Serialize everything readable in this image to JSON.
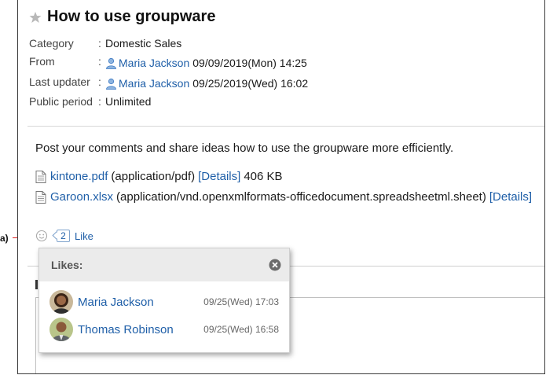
{
  "title": "How to use groupware",
  "meta": [
    {
      "label": "Category",
      "value": "Domestic Sales"
    },
    {
      "label": "From",
      "user": "Maria Jackson",
      "value": "09/09/2019(Mon) 14:25"
    },
    {
      "label": "Last updater",
      "user": "Maria Jackson",
      "value": "09/25/2019(Wed) 16:02"
    },
    {
      "label": "Public period",
      "value": "Unlimited"
    }
  ],
  "body": "Post your comments and share ideas how to use the groupware more efficiently.",
  "attachments": [
    {
      "name": "kintone.pdf",
      "type": "(application/pdf)",
      "details": "[Details]",
      "size": "406 KB"
    },
    {
      "name": "Garoon.xlsx",
      "type": "(application/vnd.openxmlformats-officedocument.spreadsheetml.sheet)",
      "details": "[Details]"
    }
  ],
  "likes": {
    "count": "2",
    "label": "Like",
    "popup_title": "Likes:",
    "items": [
      {
        "name": "Maria Jackson",
        "time": "09/25(Wed) 17:03"
      },
      {
        "name": "Thomas Robinson",
        "time": "09/25(Wed) 16:58"
      }
    ]
  },
  "annotation": "a)",
  "colors": {
    "link": "#1f5fa8",
    "annotation": "#dd2222",
    "popup_header": "#ebebeb"
  }
}
